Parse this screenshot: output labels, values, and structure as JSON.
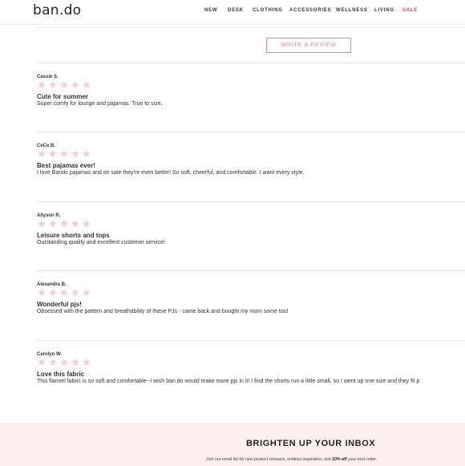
{
  "header": {
    "logo": "ban.do",
    "nav": [
      "NEW",
      "DESK",
      "CLOTHING",
      "ACCESSORIES",
      "WELLNESS",
      "LIVING",
      "SALE"
    ]
  },
  "reviews_section": {
    "write_review_label": "WRITE A REVIEW",
    "star_color": "#f6c9d4",
    "reviews": [
      {
        "name": "Cassie S.",
        "title": "Cute for summer",
        "body": "Super comfy for lounge and pajamas. True to size."
      },
      {
        "name": "CeCe B.",
        "title": "Best pajamas ever!",
        "body": "I love Bando pajamas and on sale they're even better! So soft, cheerful, and comfortable. I want every style."
      },
      {
        "name": "Allyson R.",
        "title": "Leisure shorts and tops",
        "body": "Outstanding quality and excellent customer service!"
      },
      {
        "name": "Alexandra B.",
        "title": "Wonderful pjs!",
        "body": "Obsessed with the pattern and breathability of these PJs - came back and bought my mom some too!"
      },
      {
        "name": "Carolyn W.",
        "title": "Love this fabric",
        "body": "This flannel fabric is so soft and comfortable--I wish ban.do would make more pjs in it! I find the shorts run a little small, so I went up one size and they fit p"
      }
    ]
  },
  "newsletter": {
    "title": "BRIGHTEN UP YOUR INBOX",
    "text_before": "Join our email list for new product releases, endless inspiration, and ",
    "text_bold": "10% off",
    "text_after": " your next order.",
    "background": "#fdf0ee"
  },
  "accent_color": "#f07f98",
  "sale_color": "#e8385f"
}
